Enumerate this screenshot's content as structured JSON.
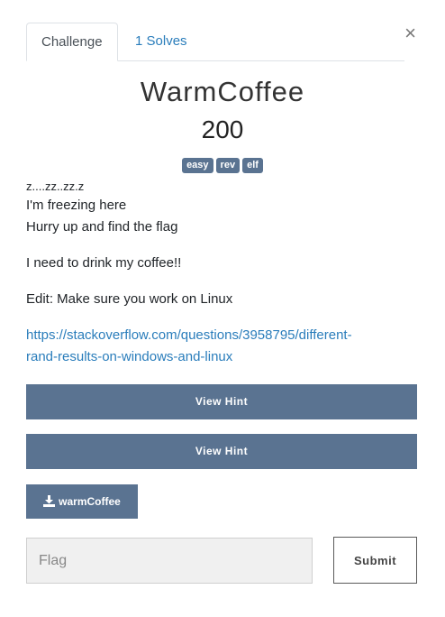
{
  "tabs": {
    "challenge_label": "Challenge",
    "solves_label": "1 Solves"
  },
  "close_icon_glyph": "×",
  "challenge": {
    "name": "WarmCoffee",
    "points": "200",
    "tags": [
      "easy",
      "rev",
      "elf"
    ],
    "description": {
      "line1": "z....zz..zz.z",
      "line2": "I'm freezing here",
      "line3": "Hurry up and find the flag",
      "line4": "I need to drink my coffee!!",
      "line5": "Edit: Make sure you work on Linux",
      "link_line1": "https://stackoverflow.com/questions/3958795/different-",
      "link_line2": "rand-results-on-windows-and-linux"
    }
  },
  "hints": [
    {
      "label": "View Hint"
    },
    {
      "label": "View Hint"
    }
  ],
  "file": {
    "label": "warmCoffee",
    "icon": "download-icon"
  },
  "flag_form": {
    "placeholder": "Flag",
    "submit_label": "Submit"
  },
  "colors": {
    "accent": "#5a7391",
    "link": "#2a7dbb"
  }
}
